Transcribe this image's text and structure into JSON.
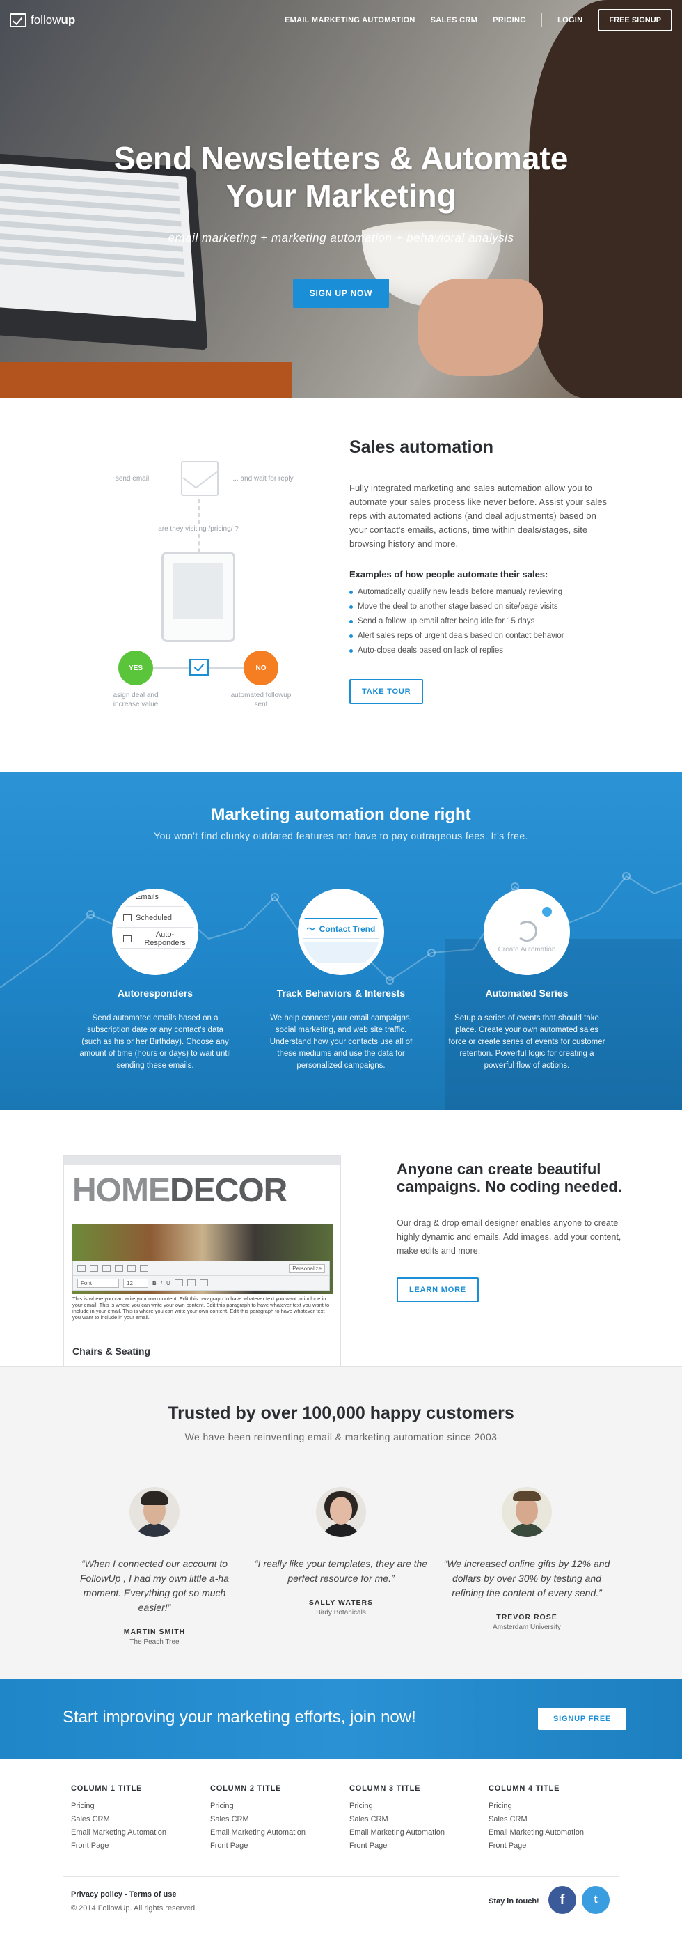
{
  "nav": {
    "logo_prefix": "follow",
    "logo_suffix": "up",
    "links": [
      "EMAIL MARKETING AUTOMATION",
      "SALES CRM",
      "PRICING"
    ],
    "login": "LOGIN",
    "signup": "FREE SIGNUP"
  },
  "hero": {
    "title": "Send Newsletters & Automate Your Marketing",
    "subtitle": "email marketing + marketing automation + behavioral analysis",
    "cta": "SIGN UP NOW"
  },
  "sales": {
    "diagram": {
      "send_email": "send email",
      "wait": "... and wait for reply",
      "visiting": "are they visiting /pricing/ ?",
      "yes": "YES",
      "no": "NO",
      "yes_action": "asign deal and increase value",
      "no_action": "automated followup sent"
    },
    "title": "Sales automation",
    "body": "Fully integrated marketing and sales automation allow you to automate your sales process like never before. Assist your sales reps with automated actions (and deal adjustments) based on your contact's emails, actions, time within deals/stages, site browsing history and more.",
    "examples_title": "Examples of how people automate their sales:",
    "examples": [
      "Automatically qualify new leads before manualy reviewing",
      "Move the deal to another stage based on site/page visits",
      "Send a follow up email after being idle for 15 days",
      "Alert sales reps of urgent deals based on contact behavior",
      "Auto-close deals based on lack of replies"
    ],
    "cta": "TAKE TOUR"
  },
  "marketing": {
    "title": "Marketing automation done right",
    "subtitle": "You won't find clunky outdated features nor have to pay outrageous fees. It's free.",
    "features": [
      {
        "ui": [
          "Emails",
          "Scheduled",
          "Auto-Responders"
        ],
        "title": "Autoresponders",
        "text": "Send automated emails based on a subscription date or any contact's data (such as his or her Birthday). Choose any amount of time (hours or days) to wait until sending these emails."
      },
      {
        "ui": [
          "Contact Trend"
        ],
        "title": "Track Behaviors & Interests",
        "text": "We help connect your email campaigns, social marketing, and web site traffic. Understand how your contacts use all of these mediums and use the data for personalized campaigns."
      },
      {
        "ui": [
          "Create Automation"
        ],
        "title": "Automated Series",
        "text": "Setup a series of events that should take place. Create your own automated sales force or create series of events for customer retention. Powerful logic for creating a powerful flow of actions."
      }
    ]
  },
  "dnd": {
    "editor": {
      "brand_light": "HOME",
      "brand_dark": "DECOR",
      "toolbar_font": "Font",
      "toolbar_size": "12",
      "toolbar_personalize": "Personalize",
      "copy": "This is where you can write your own content. Edit this paragraph to have whatever text you want to include in your email. This is where you can write your own content. Edit this paragraph to have whatever text you want to include in your email. This is where you can write your own content. Edit this paragraph to have whatever text you want to include in your email.",
      "caption": "Chairs & Seating"
    },
    "title": "Anyone can create beautiful campaigns. No coding needed.",
    "body": "Our drag & drop email designer enables anyone to create highly dynamic and emails. Add images, add your content, make edits and more.",
    "cta": "LEARN MORE"
  },
  "trust": {
    "title": "Trusted by over 100,000 happy customers",
    "subtitle": "We have been reinventing email & marketing automation since 2003",
    "testimonials": [
      {
        "quote": "“When I connected our account to FollowUp , I had my own little a-ha moment. Everything got so much easier!”",
        "name": "MARTIN SMITH",
        "org": "The Peach Tree"
      },
      {
        "quote": "“I really like your templates, they are the perfect resource for me.”",
        "name": "SALLY WATERS",
        "org": "Birdy Botanicals"
      },
      {
        "quote": "“We increased online gifts by 12% and dollars by over 30% by testing and refining the content of every send.”",
        "name": "TREVOR ROSE",
        "org": "Amsterdam University"
      }
    ]
  },
  "cta_band": {
    "text": "Start improving your marketing efforts, join now!",
    "button": "SIGNUP FREE"
  },
  "footer": {
    "columns": [
      {
        "title": "COLUMN 1 TITLE",
        "links": [
          "Pricing",
          "Sales CRM",
          "Email Marketing Automation",
          "Front Page"
        ]
      },
      {
        "title": "COLUMN 2 TITLE",
        "links": [
          "Pricing",
          "Sales CRM",
          "Email Marketing Automation",
          "Front Page"
        ]
      },
      {
        "title": "COLUMN 3 TITLE",
        "links": [
          "Pricing",
          "Sales CRM",
          "Email Marketing Automation",
          "Front Page"
        ]
      },
      {
        "title": "COLUMN 4 TITLE",
        "links": [
          "Pricing",
          "Sales CRM",
          "Email Marketing Automation",
          "Front Page"
        ]
      }
    ],
    "privacy": "Privacy policy",
    "legal_sep": " - ",
    "terms": "Terms of use",
    "copyright": "© 2014 FollowUp. All rights reserved.",
    "stay": "Stay in touch!",
    "facebook_glyph": "f",
    "twitter_glyph": "t"
  },
  "colors": {
    "accent": "#1a8ed6",
    "yes": "#5ac43b",
    "no": "#f57d22"
  }
}
